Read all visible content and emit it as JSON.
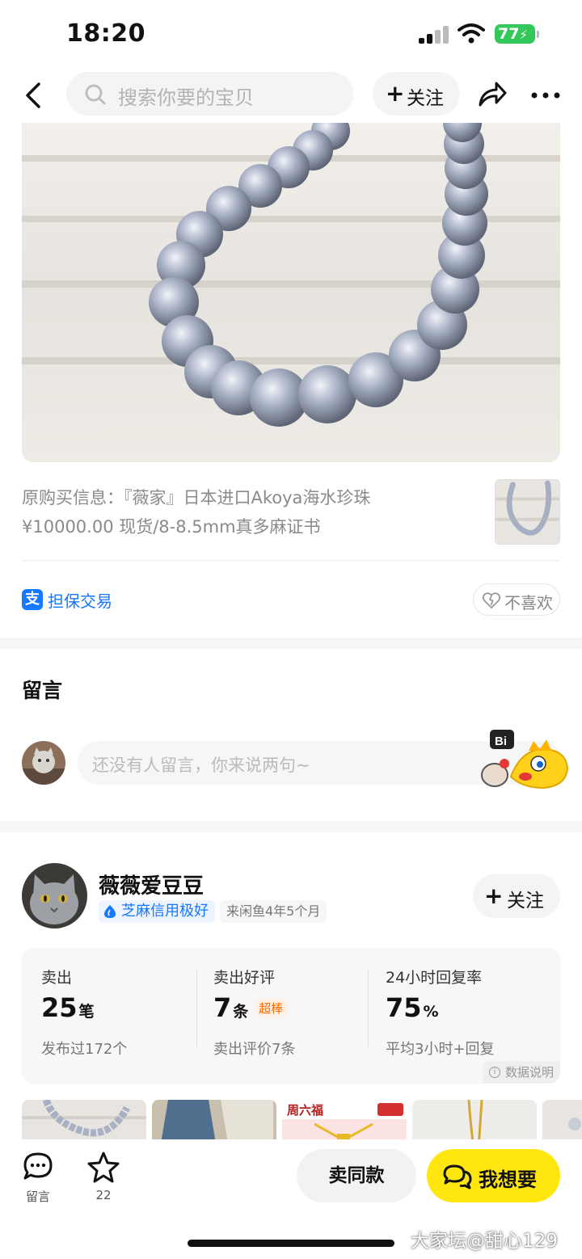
{
  "status_bar": {
    "time": "18:20",
    "battery": "77"
  },
  "nav": {
    "search_placeholder": "搜索你要的宝贝",
    "follow_label": "关注"
  },
  "product": {
    "description_line1": "原购买信息：『薇家』日本进口Akoya海水珍珠",
    "description_line2": "¥10000.00 现货/8-8.5mm真多麻证书",
    "guarantee_label": "担保交易",
    "dislike_label": "不喜欢"
  },
  "comments": {
    "title": "留言",
    "input_placeholder": "还没有人留言，你来说两句~",
    "mascot_bubble": "Bi"
  },
  "seller": {
    "name": "薇薇爱豆豆",
    "credit": "芝麻信用极好",
    "member_since": "来闲鱼4年5个月",
    "follow_label": "关注",
    "stats": [
      {
        "label": "卖出",
        "value": "25",
        "unit": "笔",
        "tag": "",
        "sub": "发布过172个"
      },
      {
        "label": "卖出好评",
        "value": "7",
        "unit": "条",
        "tag": "超棒",
        "sub": "卖出评价7条"
      },
      {
        "label": "24小时回复率",
        "value": "75",
        "unit": "%",
        "tag": "",
        "sub": "平均3小时+回复"
      }
    ],
    "data_note": "数据说明",
    "thumb_brand": "周六福"
  },
  "bottom_bar": {
    "comment_label": "留言",
    "favorite_count": "22",
    "same_label": "卖同款",
    "want_label": "我想要"
  },
  "watermark": "大家坛@甜心129",
  "colors": {
    "brand_yellow": "#ffe60f",
    "alipay_blue": "#1677ff",
    "badge_orange": "#ff6a00"
  }
}
